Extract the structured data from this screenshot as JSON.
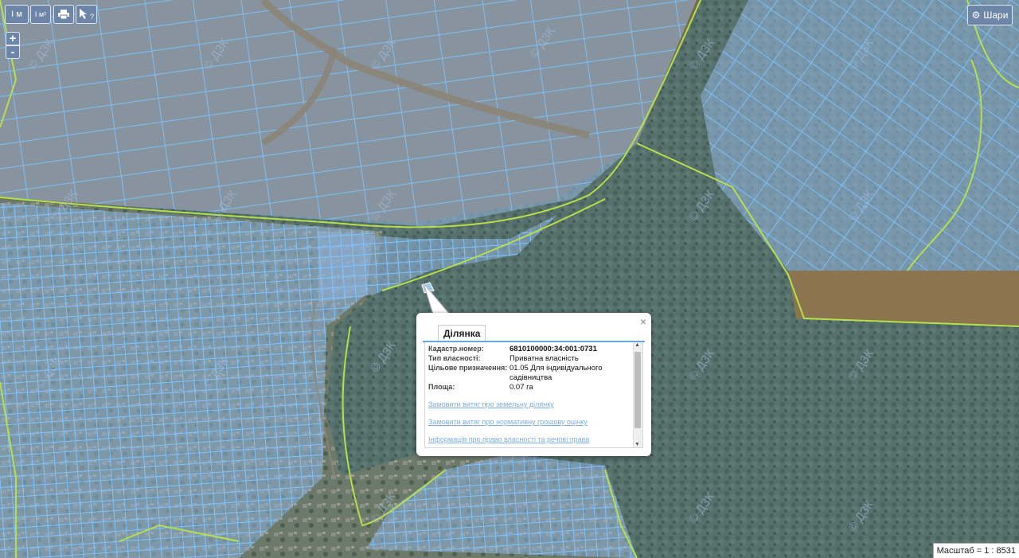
{
  "toolbar": {
    "measure_length_label": "I м",
    "measure_area_label": "I м²",
    "print_label": "print",
    "identify_label": "?"
  },
  "zoom": {
    "in_label": "+",
    "out_label": "-"
  },
  "layers_button": {
    "label": "Шари",
    "icon": "gear-icon"
  },
  "watermark": "© ДЗК",
  "popup": {
    "tab_label": "Ділянка",
    "close_label": "×",
    "fields": [
      {
        "label": "Кадастр.номер:",
        "value": "6810100000:34:001:0731"
      },
      {
        "label": "Тип власності:",
        "value": "Приватна власність"
      },
      {
        "label": "Цільове призначення:",
        "value": "01.05 Для індивідуального садівництва"
      },
      {
        "label": "Площа:",
        "value": "0.07 га"
      }
    ],
    "links": [
      "Замовити витяг про земельну ділянку",
      "Замовити витяг про нормативну грошову оцінку",
      "Інформація про право власності та речові права"
    ]
  },
  "scale": {
    "label": "Масштаб = 1 : 8531"
  },
  "colors": {
    "parcel_fill": "#8fb1d8",
    "parcel_stroke": "#7ec3ff",
    "boundary_line": "#b6e04a",
    "forest": "#4f6a63",
    "field": "#7a6a4c",
    "ui_button": "#6d86a8"
  }
}
